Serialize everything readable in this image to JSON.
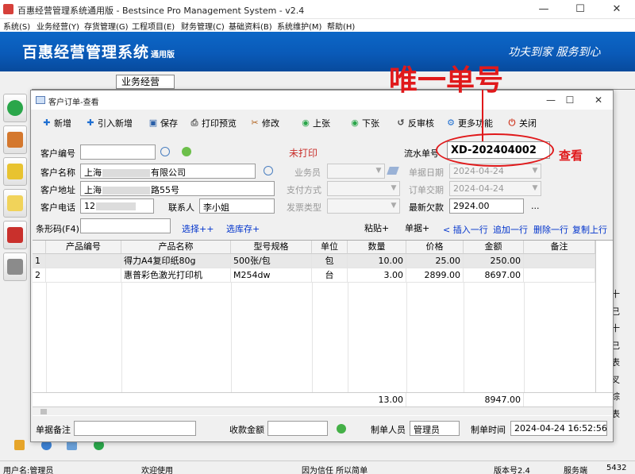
{
  "window": {
    "title": "百惠经营管理系统通用版 - Bestsince Pro Management System - v2.4",
    "controls": {
      "minimize": "—",
      "maximize": "☐",
      "close": "✕"
    }
  },
  "menu": [
    "系统(S)",
    "业务经营(Y)",
    "存货管理(G)",
    "工程项目(E)",
    "财务管理(C)",
    "基础资料(B)",
    "系统维护(M)",
    "帮助(H)"
  ],
  "banner": {
    "brand": "百惠经营管理系统",
    "brand_sub": "通用版",
    "slogan": "功夫到家 服务到心"
  },
  "main_tab": "业务经营",
  "side_chars": [
    "十",
    "己",
    "十",
    "己",
    "表",
    "叉",
    "综",
    "表"
  ],
  "dialog": {
    "title": "客户订单-查看",
    "controls": {
      "minimize": "—",
      "maximize": "☐",
      "close": "✕"
    },
    "toolbar": {
      "add": "新增",
      "import_add": "引入新增",
      "save": "保存",
      "print_preview": "打印预览",
      "edit": "修改",
      "prev": "上张",
      "next": "下张",
      "unaudit": "反审核",
      "more": "更多功能",
      "close": "关闭"
    },
    "form": {
      "customer_code_label": "客户编号",
      "customer_code_value": "",
      "print_status": "未打印",
      "serial_label": "流水单号",
      "serial_value": "XD-202404002",
      "customer_name_label": "客户名称",
      "customer_name_prefix": "上海",
      "customer_name_suffix": "有限公司",
      "salesman_label": "业务员",
      "doc_date_label": "单据日期",
      "doc_date_value": "2024-04-24",
      "address_label": "客户地址",
      "address_prefix": "上海",
      "address_suffix": "路55号",
      "pay_method_label": "支付方式",
      "order_date_label": "订单交期",
      "order_date_value": "2024-04-24",
      "phone_label": "客户电话",
      "phone_value": "12",
      "contact_label": "联系人",
      "contact_value": "李小姐",
      "invoice_type_label": "发票类型",
      "arrears_label": "最新欠款",
      "arrears_value": "2924.00",
      "ellipsis": "..."
    },
    "actions": {
      "barcode_label": "条形码(F4)",
      "barcode_value": "",
      "select": "选择++",
      "select_stock": "选库存+",
      "paste": "粘贴+",
      "price": "单据+",
      "insert_row": "< 插入一行",
      "append_row": "追加一行",
      "delete_row": "删除一行",
      "copy_row": "复制上行"
    },
    "grid": {
      "columns": [
        "产品编号",
        "产品名称",
        "型号规格",
        "单位",
        "数量",
        "价格",
        "金额",
        "备注"
      ],
      "rows": [
        {
          "no": "1",
          "code": "",
          "name": "得力A4复印纸80g",
          "spec": "500张/包",
          "unit": "包",
          "qty": "10.00",
          "price": "25.00",
          "amount": "250.00",
          "note": ""
        },
        {
          "no": "2",
          "code": "",
          "name": "惠普彩色激光打印机",
          "spec": "M254dw",
          "unit": "台",
          "qty": "3.00",
          "price": "2899.00",
          "amount": "8697.00",
          "note": ""
        }
      ],
      "totals": {
        "qty": "13.00",
        "amount": "8947.00"
      }
    },
    "footer": {
      "remark_label": "单据备注",
      "remark_value": "",
      "received_label": "收款金额",
      "received_value": "",
      "maker_label": "制单人员",
      "maker_value": "管理员",
      "make_time_label": "制单时间",
      "make_time_value": "2024-04-24 16:52:56"
    }
  },
  "annotation": {
    "headline": "唯一单号",
    "note": "查看",
    "color": "#e0191b"
  },
  "status": {
    "user": "用户名:管理员",
    "welcome": "欢迎使用",
    "motto": "因为信任 所以简单",
    "version": "版本号2.4",
    "server": "服务端",
    "port": "5432"
  },
  "colors": {
    "banner": "#0a5ab8",
    "link": "#0033cc",
    "annotation": "#e0191b"
  }
}
